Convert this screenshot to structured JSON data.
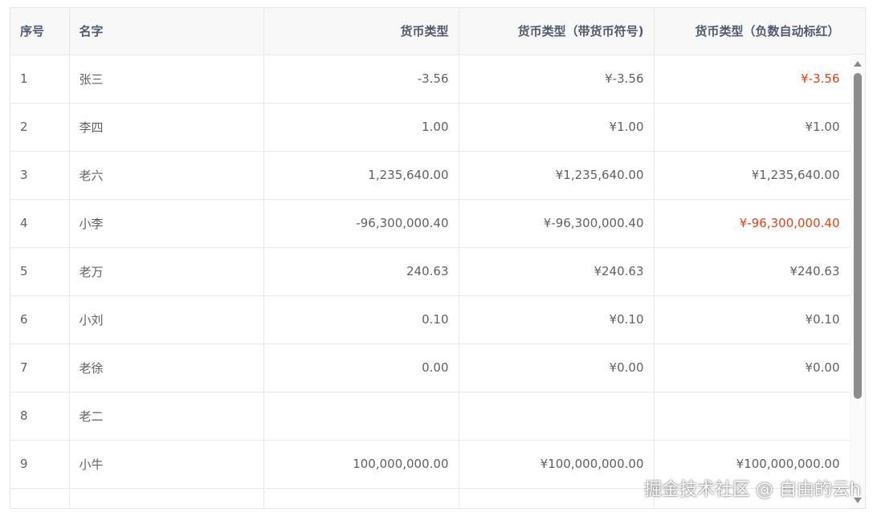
{
  "table": {
    "columns": [
      "序号",
      "名字",
      "货币类型",
      "货币类型（带货币符号)",
      "货币类型（负数自动标红）"
    ],
    "rows": [
      {
        "index": "1",
        "name": "张三",
        "currency": "-3.56",
        "currency_symbol": "¥-3.56",
        "currency_negative_red": "¥-3.56",
        "is_negative": true
      },
      {
        "index": "2",
        "name": "李四",
        "currency": "1.00",
        "currency_symbol": "¥1.00",
        "currency_negative_red": "¥1.00",
        "is_negative": false
      },
      {
        "index": "3",
        "name": "老六",
        "currency": "1,235,640.00",
        "currency_symbol": "¥1,235,640.00",
        "currency_negative_red": "¥1,235,640.00",
        "is_negative": false
      },
      {
        "index": "4",
        "name": "小李",
        "currency": "-96,300,000.40",
        "currency_symbol": "¥-96,300,000.40",
        "currency_negative_red": "¥-96,300,000.40",
        "is_negative": true
      },
      {
        "index": "5",
        "name": "老万",
        "currency": "240.63",
        "currency_symbol": "¥240.63",
        "currency_negative_red": "¥240.63",
        "is_negative": false
      },
      {
        "index": "6",
        "name": "小刘",
        "currency": "0.10",
        "currency_symbol": "¥0.10",
        "currency_negative_red": "¥0.10",
        "is_negative": false
      },
      {
        "index": "7",
        "name": "老徐",
        "currency": "0.00",
        "currency_symbol": "¥0.00",
        "currency_negative_red": "¥0.00",
        "is_negative": false
      },
      {
        "index": "8",
        "name": "老二",
        "currency": "",
        "currency_symbol": "",
        "currency_negative_red": "",
        "is_negative": false
      },
      {
        "index": "9",
        "name": "小牛",
        "currency": "100,000,000.00",
        "currency_symbol": "¥100,000,000.00",
        "currency_negative_red": "¥100,000,000.00",
        "is_negative": false
      },
      {
        "index": "",
        "name": "",
        "currency": "",
        "currency_symbol": "",
        "currency_negative_red": "",
        "is_negative": false
      }
    ]
  },
  "colors": {
    "negative": "#ed4014",
    "header_bg": "#f8f8f9",
    "border": "#e8eaec"
  },
  "icons": [
    "scroll-up-arrow-icon",
    "scroll-down-arrow-icon"
  ],
  "watermark": "掘金技术社区 @ 自由的云h"
}
